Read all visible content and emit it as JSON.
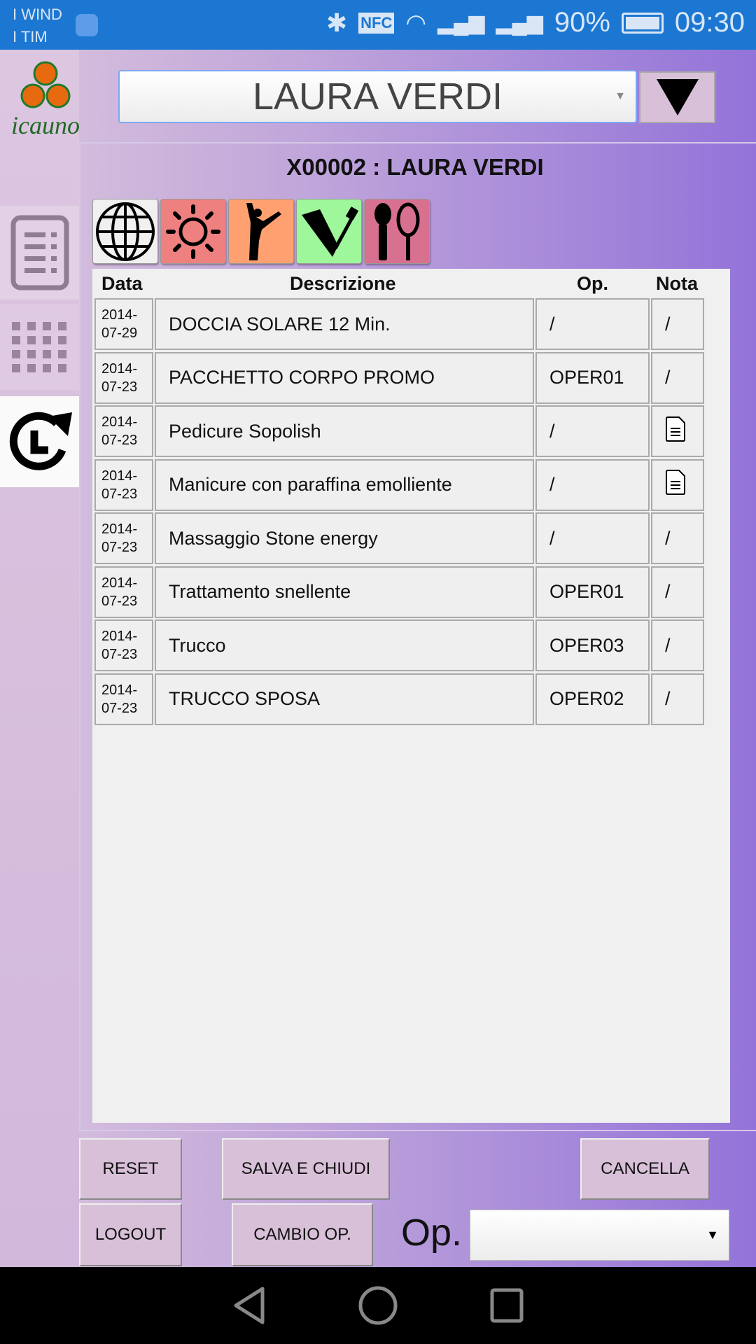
{
  "status_bar": {
    "carrier1": "I WIND",
    "carrier2": "I TIM",
    "nfc": "NFC",
    "battery": "90%",
    "time": "09:30"
  },
  "logo": {
    "text": "icauno"
  },
  "client_select": {
    "value": "LAURA VERDI"
  },
  "title": "X00002 : LAURA VERDI",
  "sidebar": {
    "items": [
      {
        "icon": "list-document-icon"
      },
      {
        "icon": "grid-icon"
      },
      {
        "icon": "history-icon",
        "selected": true
      }
    ]
  },
  "categories": [
    {
      "icon": "globe-icon",
      "color": "#f0f0f0"
    },
    {
      "icon": "sun-icon",
      "color": "#ee8080"
    },
    {
      "icon": "body-fitness-icon",
      "color": "#ffa070"
    },
    {
      "icon": "nail-polish-icon",
      "color": "#9ef79a"
    },
    {
      "icon": "makeup-brush-mirror-icon",
      "color": "#d87090"
    }
  ],
  "table": {
    "headers": [
      "Data",
      "Descrizione",
      "Op.",
      "Nota"
    ],
    "rows": [
      {
        "date1": "2014-",
        "date2": "07-29",
        "desc": "DOCCIA SOLARE 12 Min.",
        "op": "/",
        "nota": "/"
      },
      {
        "date1": "2014-",
        "date2": "07-23",
        "desc": "PACCHETTO CORPO PROMO",
        "op": "OPER01",
        "nota": "/"
      },
      {
        "date1": "2014-",
        "date2": "07-23",
        "desc": "Pedicure Sopolish",
        "op": "/",
        "nota": "note-icon"
      },
      {
        "date1": "2014-",
        "date2": "07-23",
        "desc": "Manicure con paraffina emolliente",
        "op": "/",
        "nota": "note-icon"
      },
      {
        "date1": "2014-",
        "date2": "07-23",
        "desc": "Massaggio Stone energy",
        "op": "/",
        "nota": "/"
      },
      {
        "date1": "2014-",
        "date2": "07-23",
        "desc": "Trattamento snellente",
        "op": "OPER01",
        "nota": "/"
      },
      {
        "date1": "2014-",
        "date2": "07-23",
        "desc": "Trucco",
        "op": "OPER03",
        "nota": "/"
      },
      {
        "date1": "2014-",
        "date2": "07-23",
        "desc": "TRUCCO SPOSA",
        "op": "OPER02",
        "nota": "/"
      }
    ]
  },
  "buttons": {
    "reset": "RESET",
    "save_close": "SALVA E CHIUDI",
    "cancel": "CANCELLA",
    "logout": "LOGOUT",
    "change_op": "CAMBIO OP."
  },
  "op_label": "Op.",
  "op_select": {
    "value": ""
  }
}
